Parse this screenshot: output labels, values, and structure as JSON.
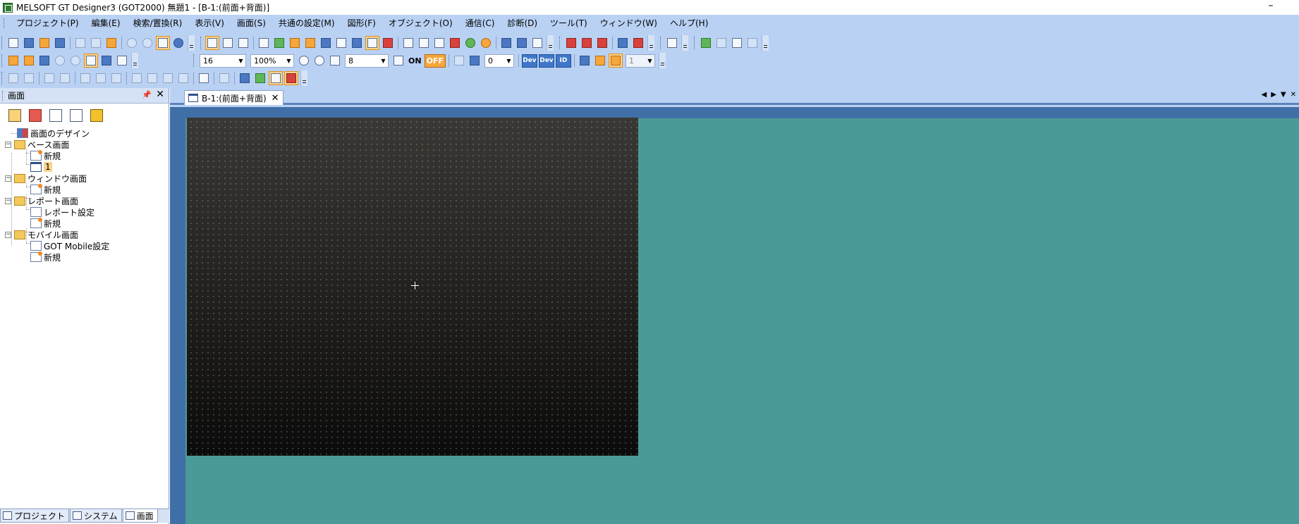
{
  "window": {
    "title": "MELSOFT GT Designer3 (GOT2000) 無題1 - [B-1:(前面+背面)]",
    "minimize": "–"
  },
  "menubar": [
    "プロジェクト(P)",
    "編集(E)",
    "検索/置換(R)",
    "表示(V)",
    "画面(S)",
    "共通の設定(M)",
    "図形(F)",
    "オブジェクト(O)",
    "通信(C)",
    "診断(D)",
    "ツール(T)",
    "ウィンドウ(W)",
    "ヘルプ(H)"
  ],
  "toolbar": {
    "snap_size": "16",
    "zoom": "100%",
    "grid_value": "8",
    "on_label": "ON",
    "off_label": "OFF",
    "offset_value": "0",
    "dev_label": "Dev",
    "id_label": "ID",
    "layer_value": "1"
  },
  "left_panel": {
    "title": "画面",
    "pin": "📌",
    "close": "✕",
    "tree": {
      "design": "画面のデザイン",
      "base": "ベース画面",
      "base_new": "新規",
      "base_1": "1",
      "window": "ウィンドウ画面",
      "window_new": "新規",
      "report": "レポート画面",
      "report_settings": "レポート設定",
      "report_new": "新規",
      "mobile": "モバイル画面",
      "mobile_settings": "GOT Mobile設定",
      "mobile_new": "新規"
    },
    "tabs": [
      "プロジェクト",
      "システム",
      "画面"
    ]
  },
  "editor": {
    "tab_label": "B-1:(前面+背面)",
    "tab_close": "✕",
    "nav": [
      "◀",
      "▶",
      "▼",
      "✕"
    ]
  },
  "colors": {
    "chrome": "#b9d1f3",
    "canvas_bg": "#4a9b98",
    "canvas_frame": "#3f6fa6",
    "highlight": "#fbd48b"
  }
}
